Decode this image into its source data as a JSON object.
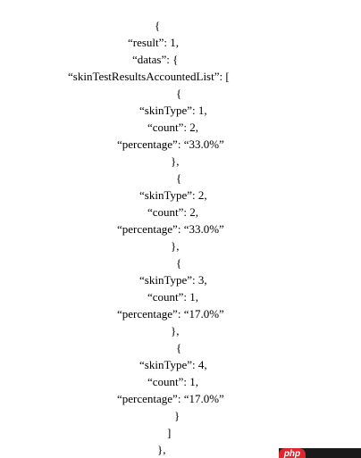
{
  "json_lines": [
    "{",
    "“result”: 1,",
    "“datas”: {",
    "“skinTestResultsAccountedList”: [",
    "{",
    "“skinType”: 1,",
    "“count”: 2,",
    "“percentage”: “33.0%”",
    "},",
    "{",
    "“skinType”: 2,",
    "“count”: 2,",
    "“percentage”: “33.0%”",
    "},",
    "{",
    "“skinType”: 3,",
    "“count”: 1,",
    "“percentage”: “17.0%”",
    "},",
    "{",
    "“skinType”: 4,",
    "“count”: 1,",
    "“percentage”: “17.0%”",
    "}",
    "]",
    "},"
  ],
  "watermark": {
    "logo_text": "php"
  },
  "colors": {
    "text": "#000000",
    "background": "#ffffff",
    "watermark_bg": "#1a1a1a",
    "watermark_logo": "#e0262d"
  }
}
